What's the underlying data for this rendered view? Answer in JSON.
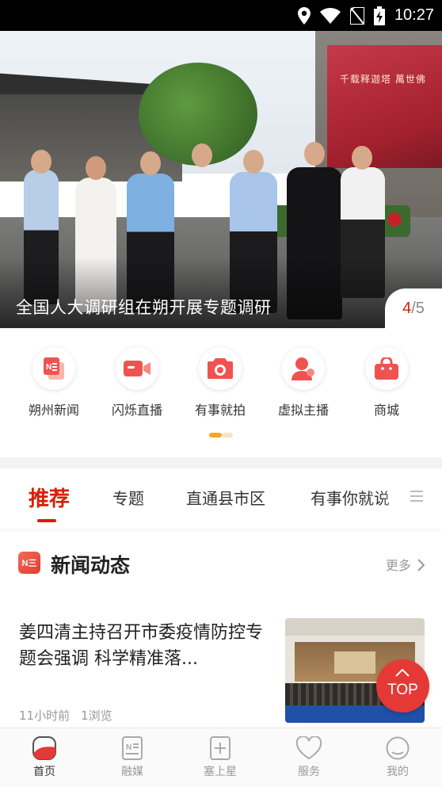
{
  "status_bar": {
    "time": "10:27"
  },
  "hero": {
    "caption": "全国人大调研组在朔开展专题调研",
    "billboard_text": "千载释迦塔  萬世佛",
    "page_current": "4",
    "page_separator": "/",
    "page_total": "5"
  },
  "quick_entries": [
    {
      "label": "朔州新闻",
      "icon": "news-paper-icon"
    },
    {
      "label": "闪烁直播",
      "icon": "video-camera-icon"
    },
    {
      "label": "有事就拍",
      "icon": "camera-icon"
    },
    {
      "label": "虚拟主播",
      "icon": "virtual-anchor-icon"
    },
    {
      "label": "商城",
      "icon": "shopping-bag-icon"
    }
  ],
  "tabs": [
    {
      "label": "推荐",
      "active": true
    },
    {
      "label": "专题"
    },
    {
      "label": "直通县市区"
    },
    {
      "label": "有事你就说"
    }
  ],
  "section": {
    "icon_text": "N三",
    "title": "新闻动态",
    "more": "更多"
  },
  "news": [
    {
      "headline": "姜四清主持召开市委疫情防控专题会强调 科学精准落...",
      "time": "11小时前",
      "views": "1浏览"
    }
  ],
  "top_button": {
    "label": "TOP"
  },
  "bottom_nav": [
    {
      "label": "首页",
      "active": true
    },
    {
      "label": "融媒"
    },
    {
      "label": "塞上星"
    },
    {
      "label": "服务"
    },
    {
      "label": "我的"
    }
  ],
  "colors": {
    "accent": "#d81e06",
    "top_button": "#e53935"
  }
}
